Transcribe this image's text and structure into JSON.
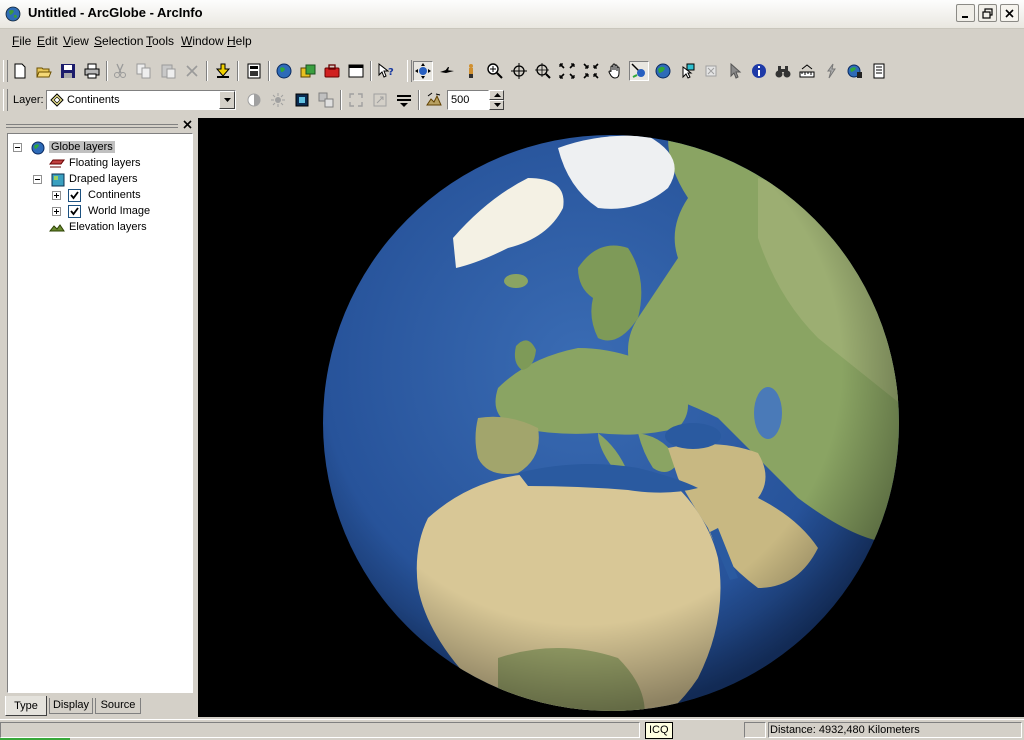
{
  "window": {
    "title": "Untitled - ArcGlobe - ArcInfo"
  },
  "menu": {
    "items": [
      {
        "accel": "F",
        "rest": "ile"
      },
      {
        "accel": "E",
        "rest": "dit"
      },
      {
        "accel": "V",
        "rest": "iew"
      },
      {
        "accel": "S",
        "rest": "election"
      },
      {
        "accel": "T",
        "rest": "ools"
      },
      {
        "accel": "W",
        "rest": "indow"
      },
      {
        "accel": "H",
        "rest": "elp"
      }
    ]
  },
  "toolbar": {
    "buttons": [
      "new-icon",
      "open-icon",
      "save-icon",
      "print-icon",
      "cut-icon",
      "copy-icon",
      "paste-icon",
      "delete-icon",
      "add-data-icon",
      "layer-properties-icon",
      "globe-icon",
      "arccatalog-icon",
      "arctoolbox-icon",
      "window-icon",
      "whats-this-icon"
    ],
    "nav_buttons": [
      "navigate-icon",
      "fly-icon",
      "observer-icon",
      "zoom-in-out-icon",
      "target-icon",
      "zoom-to-target-icon",
      "full-extent-icon",
      "zoom-extent-icon",
      "pan-icon",
      "center-target-icon",
      "globe-view-icon",
      "select-features-icon",
      "clear-selection-icon",
      "select-elements-icon",
      "identify-icon",
      "find-icon",
      "measure-icon",
      "hyperlink-icon",
      "spin-globe-icon",
      "report-icon"
    ]
  },
  "layer_toolbar": {
    "label": "Layer:",
    "selected_layer": "Continents",
    "spin_value": "500"
  },
  "toc": {
    "nodes": {
      "globe": "Globe layers",
      "floating": "Floating layers",
      "draped": "Draped layers",
      "continents": "Continents",
      "world_image": "World Image",
      "elevation": "Elevation layers"
    },
    "tabs": [
      "Type",
      "Display",
      "Source"
    ],
    "active_tab": "Type"
  },
  "status": {
    "icq": "ICQ",
    "distance": "Distance:  4932,480 Kilometers"
  },
  "colors": {
    "ocean": "#2a5aa0",
    "land": "#8fa86a",
    "desert": "#d9c89a",
    "ice": "#f4f1e4",
    "view_background": "#000000"
  }
}
